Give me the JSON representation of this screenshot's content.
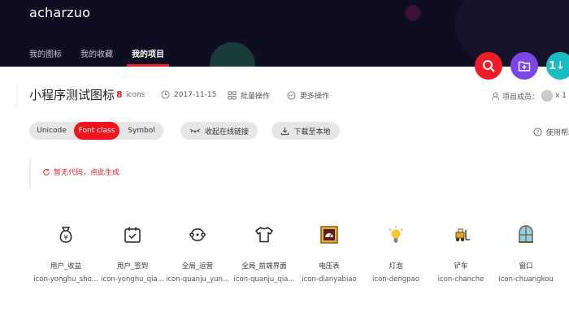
{
  "header": {
    "logo": "acharzuo",
    "tabs": [
      {
        "label": "我的图标"
      },
      {
        "label": "我的收藏"
      },
      {
        "label": "我的项目"
      }
    ]
  },
  "fab": {
    "sort_label": "1↓"
  },
  "project": {
    "title": "小程序测试图标",
    "icon_count": "8",
    "icon_count_label": "icons",
    "date": "2017-11-15",
    "batch_label": "批量操作",
    "more_label": "更多操作",
    "members_label": "项目成员：",
    "members_count": "x 1"
  },
  "toolbar": {
    "segments": [
      {
        "label": "Unicode"
      },
      {
        "label": "Font class"
      },
      {
        "label": "Symbol"
      }
    ],
    "active_segment": "Font class",
    "collapse_label": "收起在线链接",
    "download_label": "下载至本地",
    "help_label": "使用帮助"
  },
  "code_area": {
    "message": "暂无代码，点此生成"
  },
  "icons": [
    {
      "name": "用户_收益",
      "code": "icon-yonghu_sho...",
      "icon": "money-bag-icon"
    },
    {
      "name": "用户_签到",
      "code": "icon-yonghu_qia...",
      "icon": "calendar-check-icon"
    },
    {
      "name": "全局_运营",
      "code": "icon-quanju_yun...",
      "icon": "operation-cycle-icon"
    },
    {
      "name": "全局_前端界面",
      "code": "icon-quanju_qia...",
      "icon": "tshirt-icon"
    },
    {
      "name": "电压表",
      "code": "icon-dianyabiao",
      "icon": "voltmeter-icon"
    },
    {
      "name": "灯泡",
      "code": "icon-dengpao",
      "icon": "light-bulb-icon"
    },
    {
      "name": "铲车",
      "code": "icon-chanche",
      "icon": "forklift-icon"
    },
    {
      "name": "窗口",
      "code": "icon-chuangkou",
      "icon": "window-icon"
    }
  ],
  "colors": {
    "header_bg": "#0f0d22",
    "accent_red": "#e8202c",
    "fab_purple": "#7c45e6",
    "fab_teal": "#19bcc1"
  }
}
